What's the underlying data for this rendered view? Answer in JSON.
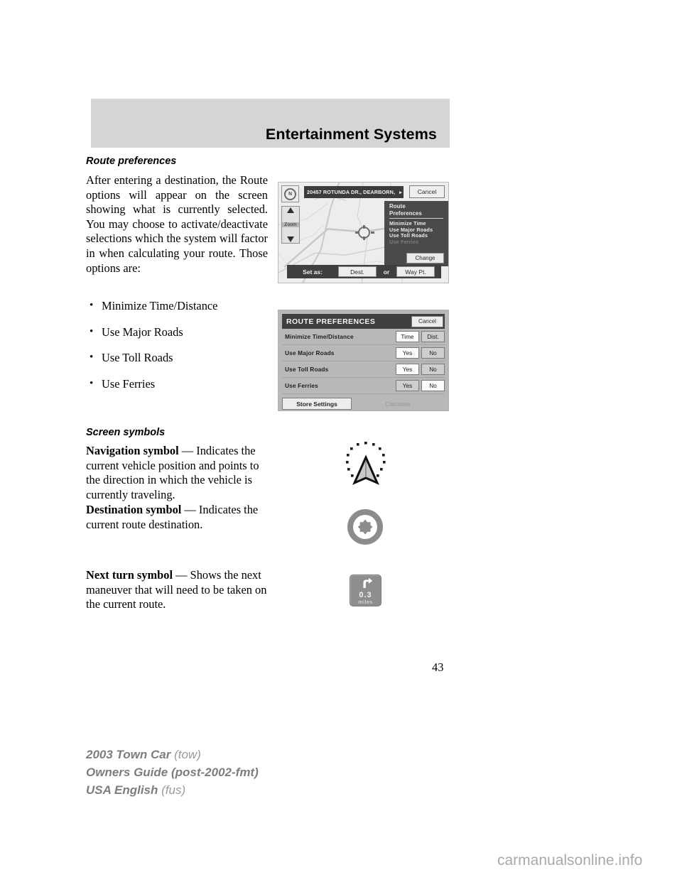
{
  "header": {
    "title": "Entertainment Systems"
  },
  "content": {
    "section1_heading": "Route preferences",
    "section1_paragraph": "After entering a destination, the Route options will appear on the screen showing what is currently selected. You may choose to activate/deactivate selections which the system will factor in when calculating your route. Those options are:",
    "bullets": [
      "Minimize Time/Distance",
      "Use Major Roads",
      "Use Toll Roads",
      "Use Ferries"
    ],
    "section2_heading": "Screen symbols",
    "symbols": [
      {
        "lead": "Navigation symbol",
        "dash": " — ",
        "body": "Indicates the current vehicle position and points to the direction in which the vehicle is currently traveling."
      },
      {
        "lead": "Destination symbol",
        "dash": " — ",
        "body": "Indicates the current route destination."
      },
      {
        "lead": "Next turn symbol",
        "dash": " — ",
        "body": "Shows the next maneuver that will need to be taken on the current route."
      }
    ]
  },
  "figure_map": {
    "compass_label": "N",
    "address": "20457 ROTUNDA DR., DEARBORN,",
    "address_arrow": "▸",
    "cancel_label": "Cancel",
    "zoom_label": "Zoom",
    "panel_title_line1": "Route",
    "panel_title_line2": "Preferences",
    "panel_items": [
      {
        "label": "Minimize Time",
        "active": true
      },
      {
        "label": "Use Major Roads",
        "active": true
      },
      {
        "label": "Use Toll Roads",
        "active": true
      },
      {
        "label": "Use Ferries",
        "active": false
      }
    ],
    "change_label": "Change",
    "set_as_label": "Set as:",
    "dest_label": "Dest.",
    "or_label": "or",
    "waypt_label": "Way Pt."
  },
  "figure_prefs": {
    "title": "ROUTE PREFERENCES",
    "cancel_label": "Cancel",
    "rows": [
      {
        "name": "Minimize Time/Distance",
        "options": [
          {
            "label": "Time",
            "selected": true
          },
          {
            "label": "Dist.",
            "selected": false
          }
        ]
      },
      {
        "name": "Use Major Roads",
        "options": [
          {
            "label": "Yes",
            "selected": true
          },
          {
            "label": "No",
            "selected": false
          }
        ]
      },
      {
        "name": "Use Toll Roads",
        "options": [
          {
            "label": "Yes",
            "selected": true
          },
          {
            "label": "No",
            "selected": false
          }
        ]
      },
      {
        "name": "Use Ferries",
        "options": [
          {
            "label": "Yes",
            "selected": false
          },
          {
            "label": "No",
            "selected": true
          }
        ]
      }
    ],
    "store_label": "Store Settings",
    "calculate_label": "Calculate"
  },
  "figure_turn_symbol": {
    "distance": "0.3",
    "unit": "miles"
  },
  "page_number": "43",
  "footer": {
    "line1_bold": "2003 Town Car",
    "line1_light": "(tow)",
    "line2_bold": "Owners Guide (post-2002-fmt)",
    "line3_bold": "USA English",
    "line3_light": "(fus)"
  },
  "watermark": "carmanualsonline.info",
  "colors": {
    "banner": "#d5d5d5",
    "footer_text": "#8a8a8a",
    "watermark": "#a9a9a9"
  }
}
